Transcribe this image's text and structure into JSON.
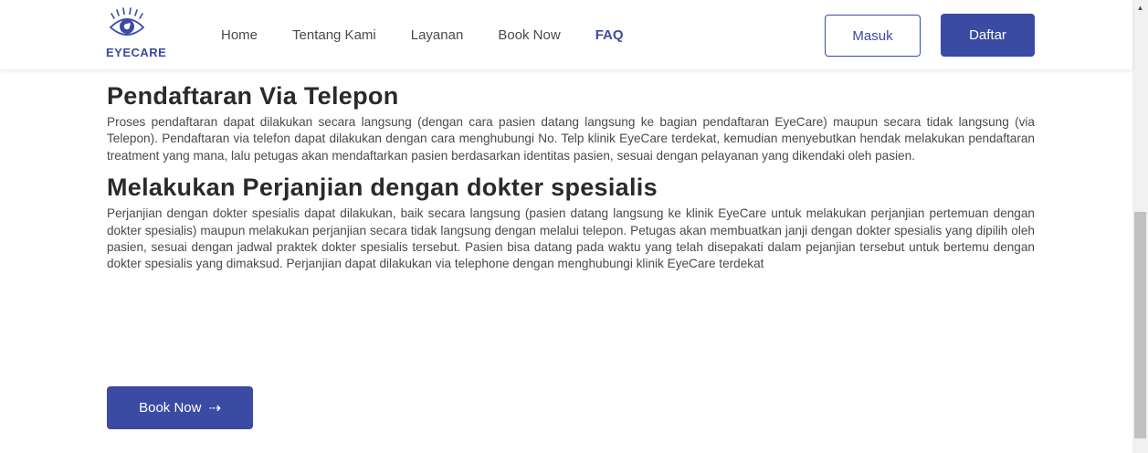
{
  "header": {
    "logo_text": "EYECARE",
    "nav": [
      {
        "label": "Home"
      },
      {
        "label": "Tentang Kami"
      },
      {
        "label": "Layanan"
      },
      {
        "label": "Book Now"
      },
      {
        "label": "FAQ"
      }
    ],
    "login_label": "Masuk",
    "register_label": "Daftar"
  },
  "sections": [
    {
      "title": "Pendaftaran Via Telepon",
      "body": "Proses pendaftaran dapat dilakukan secara langsung (dengan cara pasien datang langsung ke bagian pendaftaran EyeCare) maupun secara tidak langsung (via Telepon). Pendaftaran via telefon dapat dilakukan dengan cara menghubungi No. Telp klinik EyeCare terdekat, kemudian menyebutkan hendak melakukan pendaftaran treatment yang mana, lalu petugas akan mendaftarkan pasien berdasarkan identitas pasien, sesuai dengan pelayanan yang dikendaki oleh pasien."
    },
    {
      "title": "Melakukan Perjanjian dengan dokter spesialis",
      "body": "Perjanjian dengan dokter spesialis dapat dilakukan, baik secara langsung (pasien datang langsung ke klinik EyeCare untuk melakukan perjanjian pertemuan dengan dokter spesialis) maupun melakukan perjanjian secara tidak langsung dengan melalui telepon. Petugas akan membuatkan janji dengan dokter spesialis yang dipilih oleh pasien, sesuai dengan jadwal praktek dokter spesialis tersebut. Pasien bisa datang pada waktu yang telah disepakati dalam pejanjian tersebut untuk bertemu dengan dokter spesialis yang dimaksud. Perjanjian dapat dilakukan via telephone dengan menghubungi klinik EyeCare terdekat"
    }
  ],
  "cta": {
    "label": "Book Now",
    "arrow": "⇢"
  },
  "colors": {
    "brand": "#3b4aa3"
  }
}
